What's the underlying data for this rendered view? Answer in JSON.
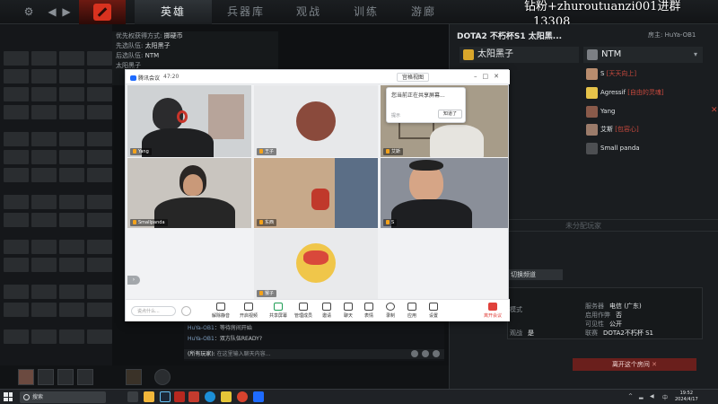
{
  "dota": {
    "nav_tabs": [
      "英雄",
      "兵器库",
      "观战",
      "训练",
      "游廊"
    ],
    "overlay_line1": "钻粉+zhuroutuanzi001进群",
    "overlay_line2": "13308",
    "lobby_info": [
      {
        "label": "优先权获得方式:",
        "value": "掷硬币"
      },
      {
        "label": "先选队伍:",
        "value": "太阳黑子"
      },
      {
        "label": "后选队伍:",
        "value": "NTM"
      },
      {
        "label": "太阳黑子",
        "value": ""
      }
    ],
    "lobby_title": "DOTA2 不朽杯S1 太阳黑...",
    "host_label": "房主: HuYa-OB1",
    "team_radiant": "太阳黑子",
    "team_dire": "NTM",
    "dire_players": [
      {
        "name": "S",
        "tag": "[天天向上]"
      },
      {
        "name": "Agressif",
        "tag": "[自由的灵魂]"
      },
      {
        "name": "Yang",
        "tag": ""
      },
      {
        "name": "艾斯",
        "tag": "[包容心]"
      },
      {
        "name": "Small panda",
        "tag": ""
      }
    ],
    "unassigned_label": "未分配玩家",
    "channel_button": "切换频道",
    "lobby_details": [
      {
        "label": "模式",
        "value": ""
      },
      {
        "label": "服务器",
        "value": "电信 (广东)"
      },
      {
        "label": "启用作弊",
        "value": "否"
      },
      {
        "label": "可见性",
        "value": "公开"
      },
      {
        "label": "联赛",
        "value": "DOTA2不朽杯 S1"
      },
      {
        "label": "观战",
        "value": "是"
      }
    ],
    "leave_button": "离开这个房间",
    "chat_messages": [
      {
        "user": "HuYa-OB1",
        "text": "：等待房间开始"
      },
      {
        "user": "HuYa-OB1",
        "text": "：双方队伍READY?"
      }
    ],
    "chat_prefix": "(所有玩家):",
    "chat_placeholder": "在这里输入聊天内容..."
  },
  "meeting": {
    "app_name": "腾讯会议",
    "time": "47:20",
    "view_button": "宫格视图",
    "popup_text": "您当前正在共享屏幕...",
    "popup_hint": "提示",
    "popup_button": "知道了",
    "participants": [
      {
        "name": "Yang"
      },
      {
        "name": "王子"
      },
      {
        "name": "艾斯"
      },
      {
        "name": "Smallpanda"
      },
      {
        "name": "东西"
      },
      {
        "name": "S"
      },
      {
        "name": "猴子"
      }
    ],
    "chat_placeholder": "说点什么...",
    "toolbar": [
      {
        "label": "解除静音"
      },
      {
        "label": "开启视频"
      },
      {
        "label": "共享屏幕"
      },
      {
        "label": "管理成员"
      },
      {
        "label": "邀请"
      },
      {
        "label": "聊天"
      },
      {
        "label": "表情"
      },
      {
        "label": "录制"
      },
      {
        "label": "应用"
      },
      {
        "label": "设置"
      }
    ],
    "leave_label": "离开会议"
  },
  "taskbar": {
    "search_text": "搜索",
    "time": "19:52",
    "date": "2024/4/17"
  }
}
